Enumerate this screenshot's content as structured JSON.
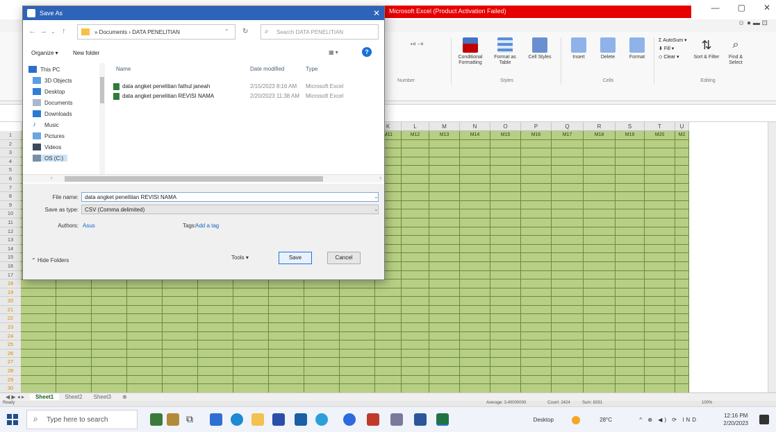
{
  "excel": {
    "activation_text": "Microsoft Excel (Product Activation Failed)",
    "ribbon_groups": [
      {
        "label": "Number"
      },
      {
        "label": "Styles"
      },
      {
        "label": "Cells"
      },
      {
        "label": "Editing"
      }
    ],
    "ribbon_buttons": {
      "conditional": "Conditional Formatting",
      "format_table": "Format as Table",
      "cell_styles": "Cell Styles",
      "insert": "Insert",
      "delete": "Delete",
      "format": "Format",
      "autosum": "AutoSum",
      "fill": "Fill",
      "clear": "Clear",
      "sort": "Sort & Filter",
      "find": "Find & Select"
    },
    "column_headers": [
      "K",
      "L",
      "M",
      "N",
      "O",
      "P",
      "Q",
      "R",
      "S",
      "T",
      "U"
    ],
    "header_row": [
      "M11",
      "M12",
      "M13",
      "M14",
      "M15",
      "M16",
      "M17",
      "M18",
      "M19",
      "M20",
      "M2"
    ],
    "row_numbers": [
      "1",
      "2",
      "3",
      "4",
      "5",
      "6",
      "7",
      "8",
      "9",
      "10",
      "11",
      "12",
      "13",
      "14",
      "15",
      "16",
      "17",
      "18",
      "19",
      "20",
      "21",
      "22",
      "23",
      "24",
      "25",
      "26",
      "27",
      "28",
      "29",
      "30",
      "31",
      "32",
      "33",
      "34"
    ],
    "sheet_tabs": [
      "Sheet1",
      "Sheet2",
      "Sheet3"
    ],
    "status": {
      "ready": "Ready",
      "average": "Average: 3.40000000",
      "count": "Count: 2424",
      "sum": "Sum: 8291",
      "zoom": "100%"
    }
  },
  "dialog": {
    "title": "Save As",
    "close_glyph": "✕",
    "breadcrumb": [
      "Documents",
      "DATA PENELITIAN"
    ],
    "search_placeholder": "Search DATA PENELITIAN",
    "organize_label": "Organize ▾",
    "new_folder_label": "New folder",
    "view_label": "▦ ▾",
    "nav_items": [
      "This PC",
      "3D Objects",
      "Desktop",
      "Documents",
      "Downloads",
      "Music",
      "Pictures",
      "Videos",
      "OS (C:)"
    ],
    "columns": {
      "name": "Name",
      "date": "Date modified",
      "type": "Type"
    },
    "files": [
      {
        "name": "data angket penelitian fathul janeah",
        "date": "2/15/2023 8:16 AM",
        "type": "Microsoft Excel"
      },
      {
        "name": "data angket penelitian REVISI NAMA",
        "date": "2/20/2023 11:38 AM",
        "type": "Microsoft Excel"
      }
    ],
    "file_name_label": "File name:",
    "file_name_value": "data angket penelitian REVISI NAMA",
    "save_type_label": "Save as type:",
    "save_type_value": "CSV (Comma delimited)",
    "authors_label": "Authors:",
    "authors_value": "Asus",
    "tags_label": "Tags:",
    "tags_value": "Add a tag",
    "hide_folders_label": "Hide Folders",
    "tools_label": "Tools ▾",
    "save_label": "Save",
    "cancel_label": "Cancel"
  },
  "taskbar": {
    "search_placeholder": "Type here to search",
    "desktop_label": "Desktop",
    "weather": "28°C",
    "tray_icons": "^ ⊕ ◀) ⟳ IND",
    "time": "12:16 PM",
    "date": "2/20/2023"
  },
  "colors": {
    "accent": "#2d63b8",
    "cell_fill": "#b7cf84",
    "activation_bar": "#e60000",
    "save_border": "#1a73e8"
  }
}
